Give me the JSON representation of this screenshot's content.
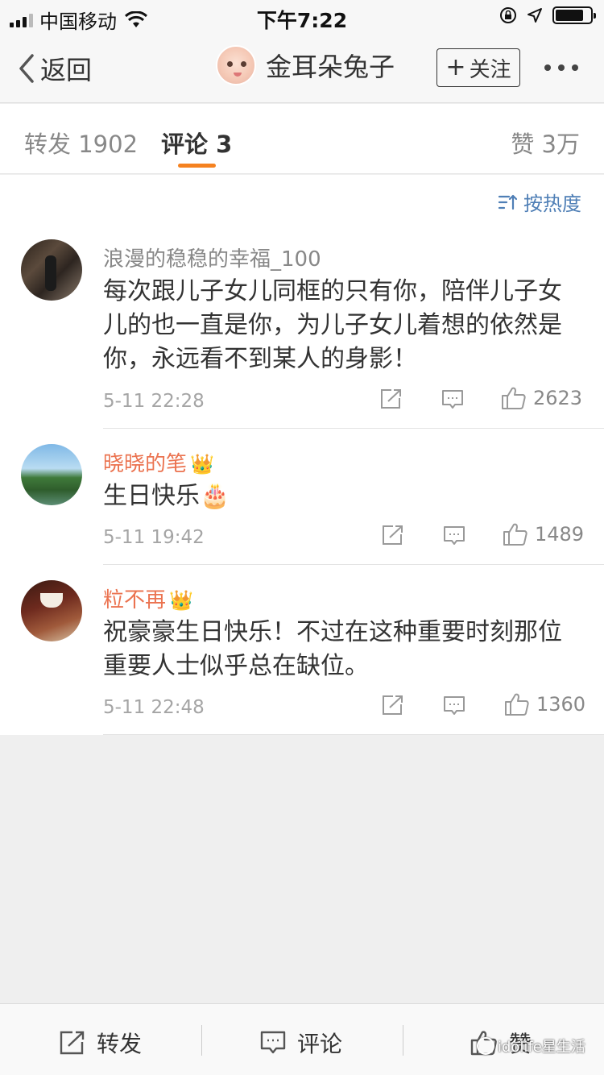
{
  "status_bar": {
    "carrier": "中国移动",
    "time": "下午7:22",
    "battery_level": 0.8
  },
  "nav": {
    "back_label": "返回",
    "title": "金耳朵兔子",
    "follow_label": "关注"
  },
  "tabs": {
    "repost": "转发 1902",
    "comment": "评论 3",
    "like": "赞 3万"
  },
  "sort": {
    "label": "按热度"
  },
  "comments": [
    {
      "user": "浪漫的稳稳的幸福_100",
      "vip": false,
      "text_lines": [
        "每次跟儿子女儿同框的只有你，陪伴儿子女",
        "儿的也一直是你，为儿子女儿着想的依然是",
        "你，永远看不到某人的身影！"
      ],
      "time": "5-11 22:28",
      "likes": "2623"
    },
    {
      "user": "晓晓的笔",
      "vip": true,
      "text_lines": [
        "生日快乐🎂"
      ],
      "time": "5-11 19:42",
      "likes": "1489"
    },
    {
      "user": "粒不再",
      "vip": true,
      "text_lines": [
        "祝豪豪生日快乐！不过在这种重要时刻那位",
        "重要人士似乎总在缺位。"
      ],
      "time": "5-11 22:48",
      "likes": "1360"
    }
  ],
  "bottom_bar": {
    "repost": "转发",
    "comment": "评论",
    "like": "赞"
  },
  "watermark": "idolife星生活",
  "colors": {
    "accent_orange": "#f58220",
    "vip_name": "#eb7350",
    "sort_blue": "#4f7fb6"
  }
}
